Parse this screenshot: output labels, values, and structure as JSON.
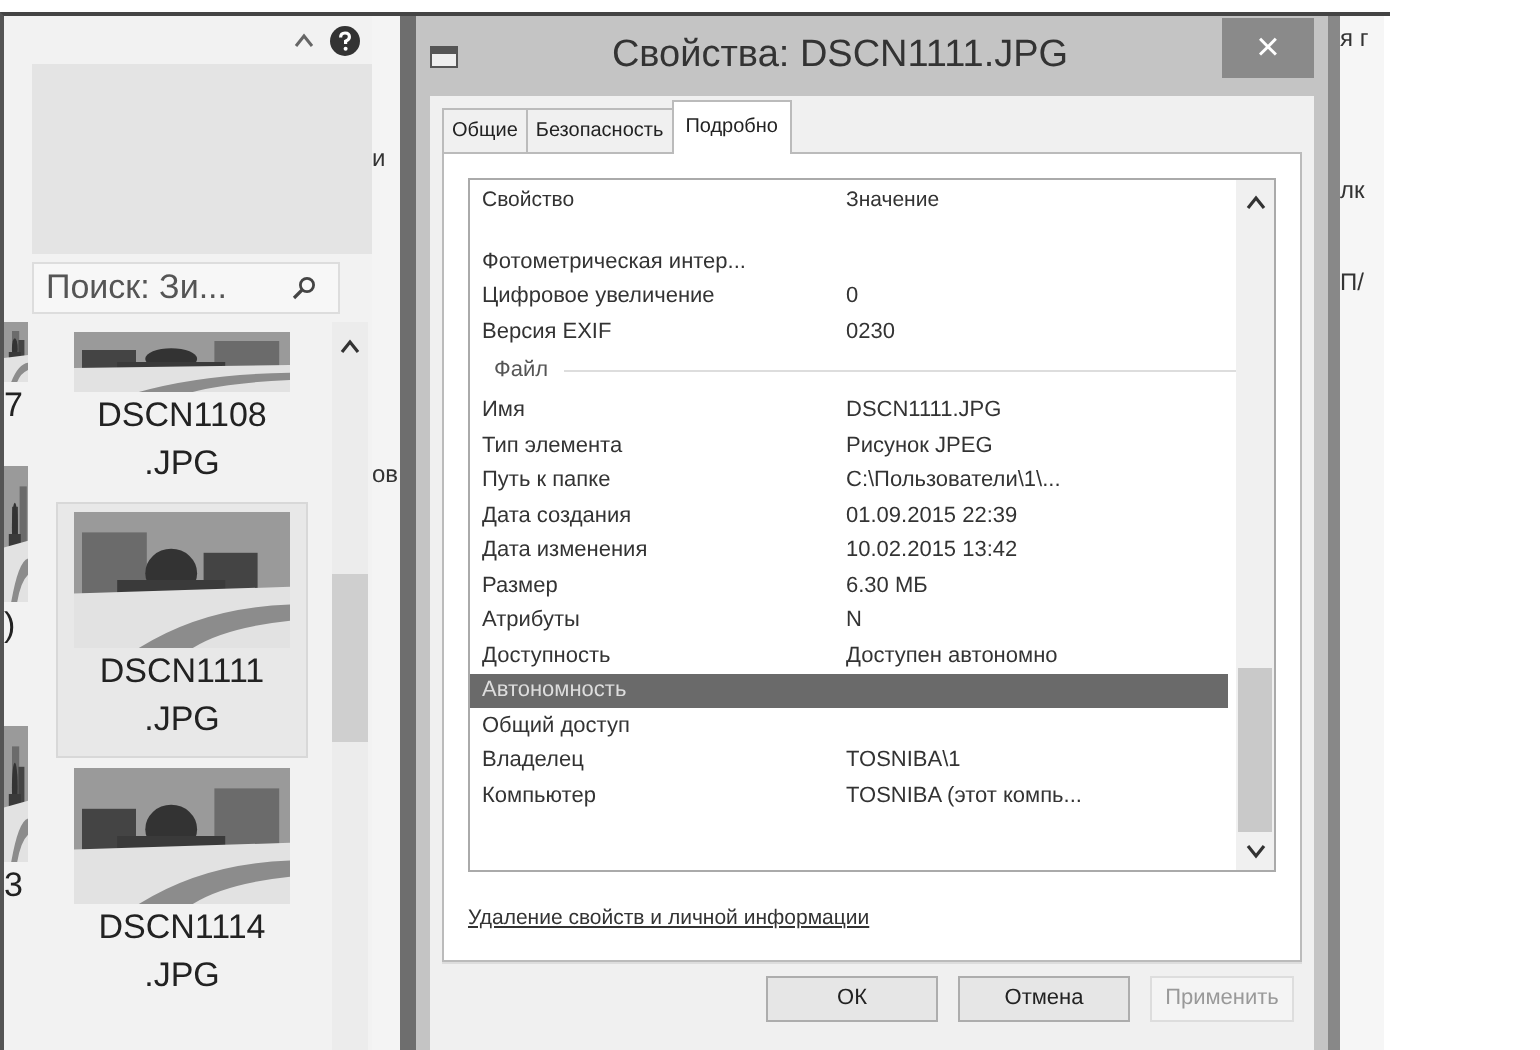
{
  "explorer": {
    "search": {
      "placeholder": "Поиск: Зи..."
    },
    "edge_labels": [
      "7",
      ")",
      "3"
    ],
    "files": [
      {
        "name": "DSCN1108.JPG",
        "selected": false,
        "cut": true
      },
      {
        "name": "DSCN1111.JPG",
        "selected": true,
        "cut": false
      },
      {
        "name": "DSCN1114.JPG",
        "selected": false,
        "cut": false
      }
    ]
  },
  "background_fragments": {
    "left": [
      "и",
      "ов"
    ],
    "right": [
      "я г",
      "лк",
      "П/"
    ]
  },
  "dialog": {
    "title": "Свойства: DSCN1111.JPG",
    "close": "×",
    "tabs": [
      {
        "label": "Общие",
        "selected": false
      },
      {
        "label": "Безопасность",
        "selected": false
      },
      {
        "label": "Подробно",
        "selected": true
      }
    ],
    "columns": [
      "Свойство",
      "Значение"
    ],
    "rows": [
      {
        "kind": "item",
        "property": "Фотометрическая интер...",
        "value": "",
        "selected": false
      },
      {
        "kind": "item",
        "property": "Цифровое увеличение",
        "value": "0",
        "selected": false
      },
      {
        "kind": "item",
        "property": "Версия EXIF",
        "value": "0230",
        "selected": false
      },
      {
        "kind": "group",
        "property": "Файл",
        "value": "",
        "selected": false
      },
      {
        "kind": "item",
        "property": "Имя",
        "value": "DSCN1111.JPG",
        "selected": false
      },
      {
        "kind": "item",
        "property": "Тип элемента",
        "value": "Рисунок JPEG",
        "selected": false
      },
      {
        "kind": "item",
        "property": "Путь к папке",
        "value": "C:\\Пользователи\\1\\...",
        "selected": false
      },
      {
        "kind": "item",
        "property": "Дата создания",
        "value": "01.09.2015 22:39",
        "selected": false
      },
      {
        "kind": "item",
        "property": "Дата изменения",
        "value": "10.02.2015 13:42",
        "selected": false
      },
      {
        "kind": "item",
        "property": "Размер",
        "value": "6.30 МБ",
        "selected": false
      },
      {
        "kind": "item",
        "property": "Атрибуты",
        "value": "N",
        "selected": false
      },
      {
        "kind": "item",
        "property": "Доступность",
        "value": "Доступен автономно",
        "selected": false
      },
      {
        "kind": "item",
        "property": "Автономность",
        "value": "",
        "selected": true
      },
      {
        "kind": "item",
        "property": "Общий доступ",
        "value": "",
        "selected": false
      },
      {
        "kind": "item",
        "property": "Владелец",
        "value": "TOSNIBA\\1",
        "selected": false
      },
      {
        "kind": "item",
        "property": "Компьютер",
        "value": "TOSNIBA (этот компь...",
        "selected": false
      }
    ],
    "link": "Удаление свойств и личной информации",
    "buttons": [
      {
        "label": "ОК",
        "disabled": false
      },
      {
        "label": "Отмена",
        "disabled": false
      },
      {
        "label": "Применить",
        "disabled": true
      }
    ]
  }
}
